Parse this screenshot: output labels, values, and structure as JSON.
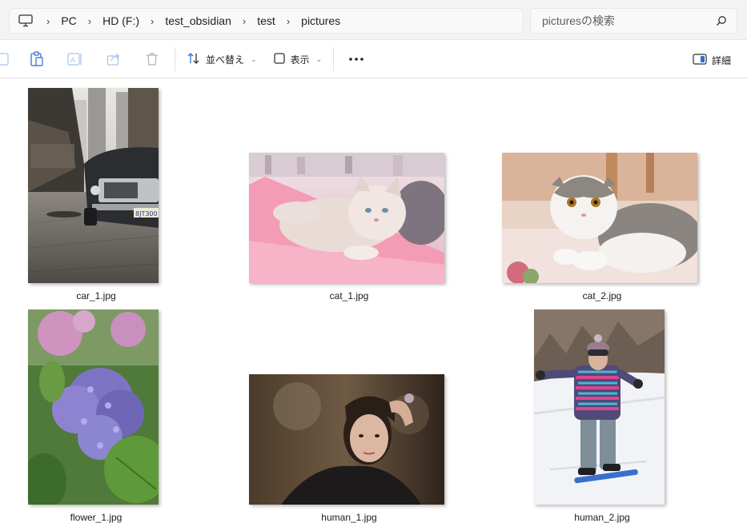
{
  "breadcrumb": {
    "items": [
      "PC",
      "HD (F:)",
      "test_obsidian",
      "test",
      "pictures"
    ]
  },
  "search": {
    "placeholder": "picturesの検索"
  },
  "toolbar": {
    "sort_label": "並べ替え",
    "view_label": "表示",
    "details_label": "詳細"
  },
  "files": [
    {
      "name": "car_1.jpg"
    },
    {
      "name": "cat_1.jpg"
    },
    {
      "name": "cat_2.jpg"
    },
    {
      "name": "flower_1.jpg"
    },
    {
      "name": "human_1.jpg"
    },
    {
      "name": "human_2.jpg"
    }
  ],
  "icons": {
    "pc": "computer-icon",
    "search": "search-icon",
    "copy": "copy-icon",
    "paste": "paste-icon",
    "rename": "rename-icon",
    "share": "share-icon",
    "delete": "delete-icon",
    "sort": "sort-icon",
    "view": "view-icon",
    "more": "more-icon",
    "details": "details-pane-icon"
  }
}
